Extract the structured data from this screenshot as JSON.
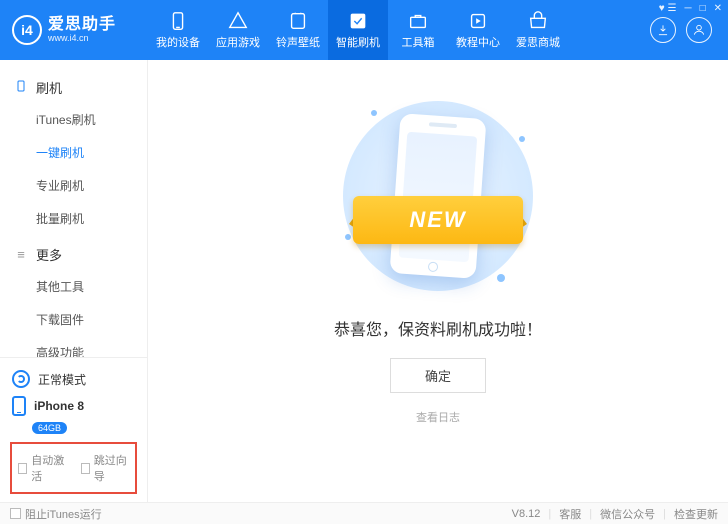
{
  "brand": {
    "title": "爱思助手",
    "sub": "www.i4.cn",
    "logo": "i4"
  },
  "nav": [
    {
      "id": "devices",
      "label": "我的设备"
    },
    {
      "id": "apps",
      "label": "应用游戏"
    },
    {
      "id": "ring",
      "label": "铃声壁纸"
    },
    {
      "id": "flash",
      "label": "智能刷机",
      "active": true
    },
    {
      "id": "tools",
      "label": "工具箱"
    },
    {
      "id": "tutorial",
      "label": "教程中心"
    },
    {
      "id": "store",
      "label": "爱思商城"
    }
  ],
  "sidebar": {
    "groups": [
      {
        "title": "刷机",
        "iconKind": "phone",
        "items": [
          {
            "id": "itunes",
            "label": "iTunes刷机"
          },
          {
            "id": "onekey",
            "label": "一键刷机",
            "active": true
          },
          {
            "id": "pro",
            "label": "专业刷机"
          },
          {
            "id": "batch",
            "label": "批量刷机"
          }
        ]
      },
      {
        "title": "更多",
        "iconKind": "more",
        "items": [
          {
            "id": "other",
            "label": "其他工具"
          },
          {
            "id": "fw",
            "label": "下载固件"
          },
          {
            "id": "adv",
            "label": "高级功能"
          }
        ]
      }
    ],
    "mode": "正常模式",
    "device": {
      "name": "iPhone 8",
      "capacity": "64GB"
    },
    "options": {
      "autoActivate": "自动激活",
      "skipGuide": "跳过向导"
    }
  },
  "main": {
    "ribbon": "NEW",
    "message": "恭喜您，保资料刷机成功啦！",
    "ok": "确定",
    "viewLog": "查看日志"
  },
  "footer": {
    "blockItunes": "阻止iTunes运行",
    "version": "V8.12",
    "links": [
      "客服",
      "微信公众号",
      "检查更新"
    ]
  }
}
